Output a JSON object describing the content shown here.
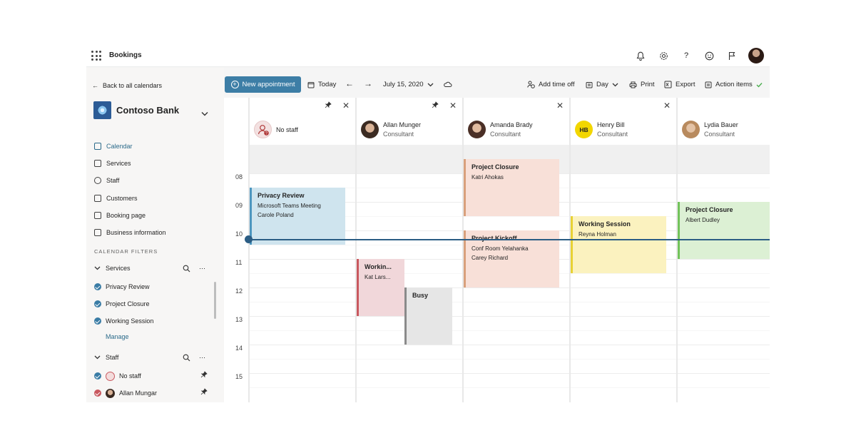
{
  "app": {
    "title": "Bookings"
  },
  "topbar": {
    "icons": [
      "bell-icon",
      "gear-icon",
      "help-icon",
      "smiley-icon",
      "flag-icon"
    ],
    "help_glyph": "?"
  },
  "sidebar": {
    "back_label": "Back to all calendars",
    "business_name": "Contoso Bank",
    "nav": [
      {
        "label": "Calendar",
        "icon": "calendar-icon",
        "active": true
      },
      {
        "label": "Services",
        "icon": "bag-icon"
      },
      {
        "label": "Staff",
        "icon": "person-icon"
      },
      {
        "label": "Customers",
        "icon": "contacts-icon"
      },
      {
        "label": "Booking page",
        "icon": "monitor-icon"
      },
      {
        "label": "Business information",
        "icon": "building-icon"
      }
    ],
    "filters_heading": "CALENDAR FILTERS",
    "services_group": {
      "label": "Services",
      "items": [
        "Privacy Review",
        "Project Closure",
        "Working Session"
      ],
      "manage_label": "Manage"
    },
    "staff_group": {
      "label": "Staff",
      "items": [
        "No staff",
        "Allan Mungar"
      ]
    },
    "more_glyph": "⋯"
  },
  "toolbar": {
    "new_appointment": "New appointment",
    "today": "Today",
    "date": "July 15, 2020",
    "add_time_off": "Add time off",
    "view": "Day",
    "print": "Print",
    "export": "Export",
    "action_items": "Action items"
  },
  "calendar": {
    "times": [
      "08",
      "09",
      "10",
      "11",
      "12",
      "13",
      "14",
      "15"
    ],
    "staff": [
      {
        "name": "No staff",
        "role": "",
        "pinned": true
      },
      {
        "name": "Allan Munger",
        "role": "Consultant",
        "pinned": true
      },
      {
        "name": "Amanda Brady",
        "role": "Consultant",
        "pinned": false
      },
      {
        "name": "Henry Bill",
        "role": "Consultant",
        "pinned": false,
        "initials": "HB"
      },
      {
        "name": "Lydia Bauer",
        "role": "Consultant",
        "pinned": false
      }
    ],
    "events": {
      "privacy_review": {
        "title": "Privacy Review",
        "l1": "Microsoft Teams Meeting",
        "l2": "Carole Poland"
      },
      "working_allan": {
        "title": "Workin...",
        "l1": "Kat Lars..."
      },
      "busy": {
        "title": "Busy"
      },
      "project_closure_amanda": {
        "title": "Project Closure",
        "l1": "Katri Ahokas"
      },
      "project_kickoff": {
        "title": "Project Kickoff",
        "l1": "Conf Room Yelahanka",
        "l2": "Carey Richard"
      },
      "working_henry": {
        "title": "Working Session",
        "l1": "Reyna Holman"
      },
      "project_closure_lydia": {
        "title": "Project Closure",
        "l1": "Albert Dudley"
      }
    },
    "colors": {
      "accent": "#3d7ea6",
      "privacy_bg": "#cfe4ee",
      "privacy_border": "#4c96bf",
      "closure_bg": "#f8e0d8",
      "closure_border": "#d9a07c",
      "working_pink_bg": "#f1d7da",
      "working_pink_border": "#c9585f",
      "busy_bg": "#e6e6e6",
      "busy_border": "#8a8a8a",
      "working_yellow_bg": "#fbf2bf",
      "working_yellow_border": "#e8d234",
      "closure_green_bg": "#dcf0d4",
      "closure_green_border": "#72c35a",
      "now_line": "#2b5d84"
    }
  }
}
